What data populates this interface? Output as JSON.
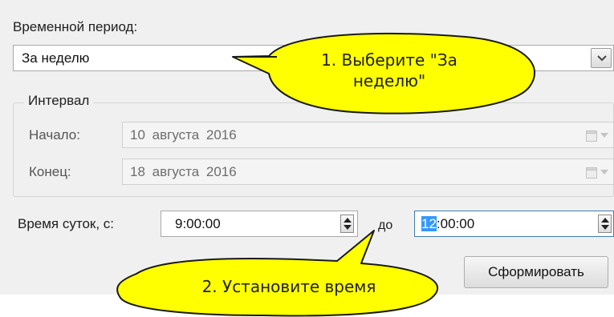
{
  "period": {
    "label": "Временной период:",
    "selected": "За неделю"
  },
  "interval": {
    "title": "Интервал",
    "start": {
      "label": "Начало:",
      "value": "10 августа 2016"
    },
    "end": {
      "label": "Конец:",
      "value": "18 августа 2016"
    }
  },
  "time_of_day": {
    "label": "Время суток, с:",
    "from_value": "9:00:00",
    "to_label": "до",
    "to_selected_part": "12",
    "to_rest": ":00:00"
  },
  "generate_button": {
    "label": "Сформировать"
  },
  "annotations": {
    "callout_1_line1": "1. Выберите \"За",
    "callout_1_line2": "неделю\"",
    "callout_2": "2. Установите время"
  },
  "colors": {
    "panel_bg": "#f0f0f0",
    "callout_fill": "#ffff00",
    "selection": "#3399ff"
  },
  "icons": [
    "chevron-down-icon",
    "calendar-icon",
    "spin-up-icon",
    "spin-down-icon"
  ]
}
